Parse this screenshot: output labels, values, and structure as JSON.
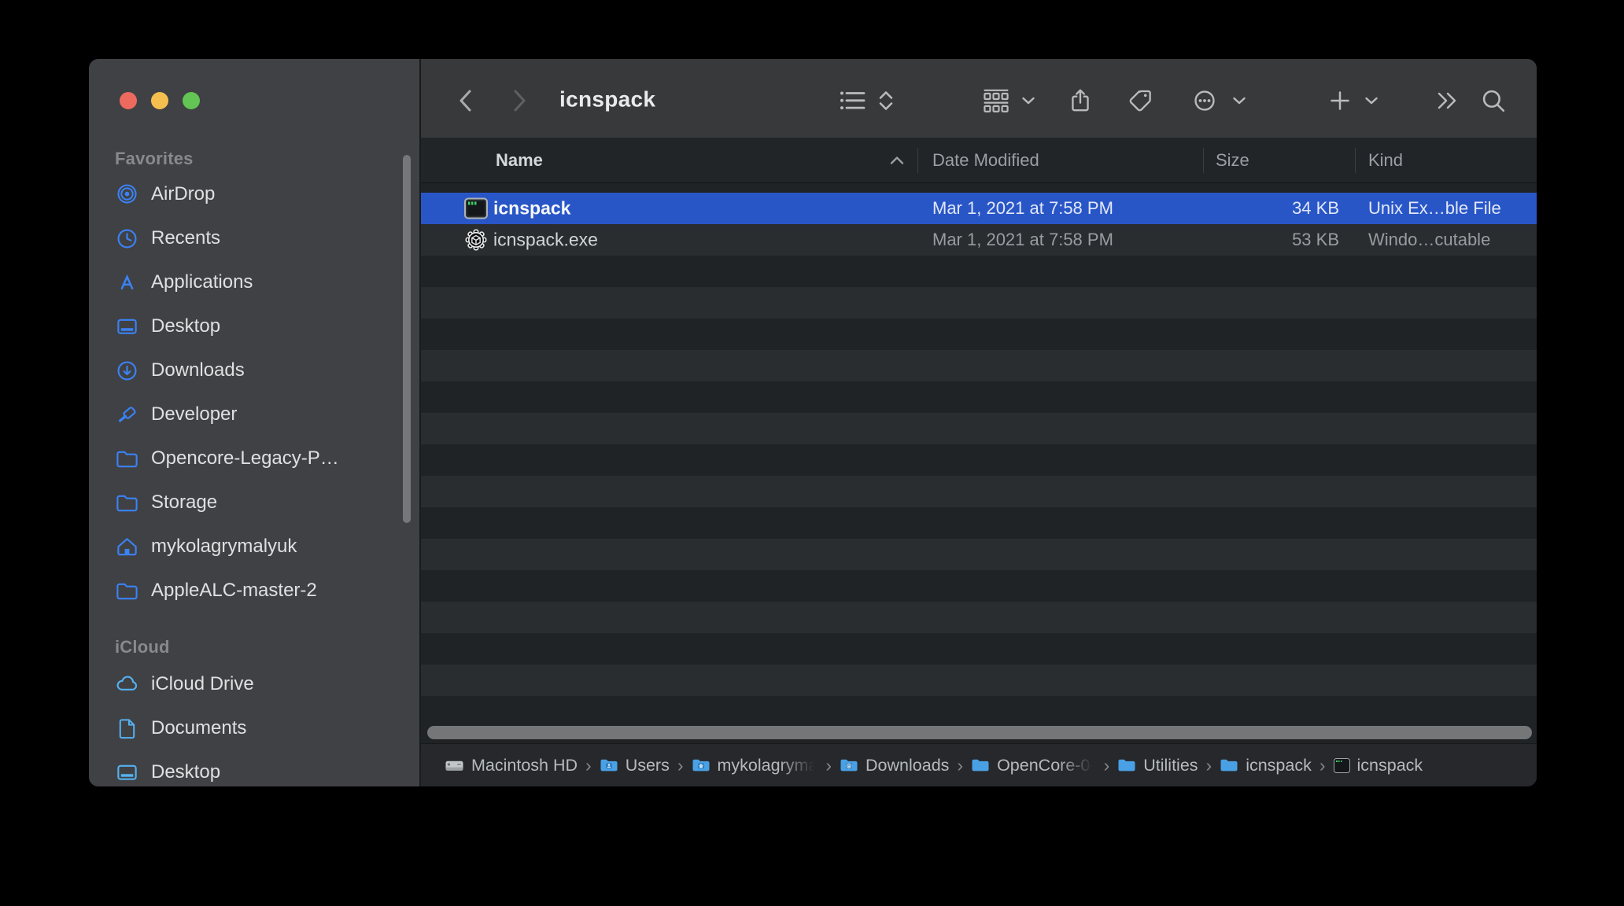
{
  "window": {
    "title": "icnspack"
  },
  "colors": {
    "selection_blue": "#2956c7",
    "sidebar_icon_blue": "#3b82f6",
    "icloud_icon_blue": "#55b1f0",
    "folder_breadcrumb_blue": "#4aa0e4",
    "traffic_red": "#ed6a5f",
    "traffic_yellow": "#f5bf4f",
    "traffic_green": "#62c554"
  },
  "sidebar": {
    "sections": [
      {
        "label": "Favorites",
        "items": [
          {
            "label": "AirDrop",
            "icon": "airdrop-icon"
          },
          {
            "label": "Recents",
            "icon": "clock-icon"
          },
          {
            "label": "Applications",
            "icon": "appstore-icon"
          },
          {
            "label": "Desktop",
            "icon": "desktop-icon"
          },
          {
            "label": "Downloads",
            "icon": "download-circle-icon"
          },
          {
            "label": "Developer",
            "icon": "hammer-icon"
          },
          {
            "label": "Opencore-Legacy-P…",
            "icon": "folder-icon"
          },
          {
            "label": "Storage",
            "icon": "folder-icon"
          },
          {
            "label": "mykolagrymalyuk",
            "icon": "home-icon"
          },
          {
            "label": "AppleALC-master-2",
            "icon": "folder-icon"
          }
        ]
      },
      {
        "label": "iCloud",
        "items": [
          {
            "label": "iCloud Drive",
            "icon": "cloud-icon"
          },
          {
            "label": "Documents",
            "icon": "document-icon"
          },
          {
            "label": "Desktop",
            "icon": "desktop-icon"
          }
        ]
      }
    ]
  },
  "list": {
    "columns": [
      "Name",
      "Date Modified",
      "Size",
      "Kind"
    ],
    "rows": [
      {
        "name": "icnspack",
        "modified": "Mar 1, 2021 at 7:58 PM",
        "size": "34 KB",
        "kind": "Unix Ex…ble File",
        "selected": true
      },
      {
        "name": "icnspack.exe",
        "modified": "Mar 1, 2021 at 7:58 PM",
        "size": "53 KB",
        "kind": "Windo…cutable",
        "selected": false
      }
    ]
  },
  "pathbar": {
    "separator": "›",
    "items": [
      {
        "label": "Macintosh HD",
        "icon": "hard-drive-icon"
      },
      {
        "label": "Users",
        "icon": "folder-users-icon"
      },
      {
        "label": "mykolagryma",
        "icon": "folder-home-icon",
        "truncated": true
      },
      {
        "label": "Downloads",
        "icon": "folder-downloads-icon"
      },
      {
        "label": "OpenCore-0-",
        "icon": "folder-icon",
        "truncated": true
      },
      {
        "label": "Utilities",
        "icon": "folder-icon"
      },
      {
        "label": "icnspack",
        "icon": "folder-icon"
      },
      {
        "label": "icnspack",
        "icon": "terminal-icon"
      }
    ]
  }
}
